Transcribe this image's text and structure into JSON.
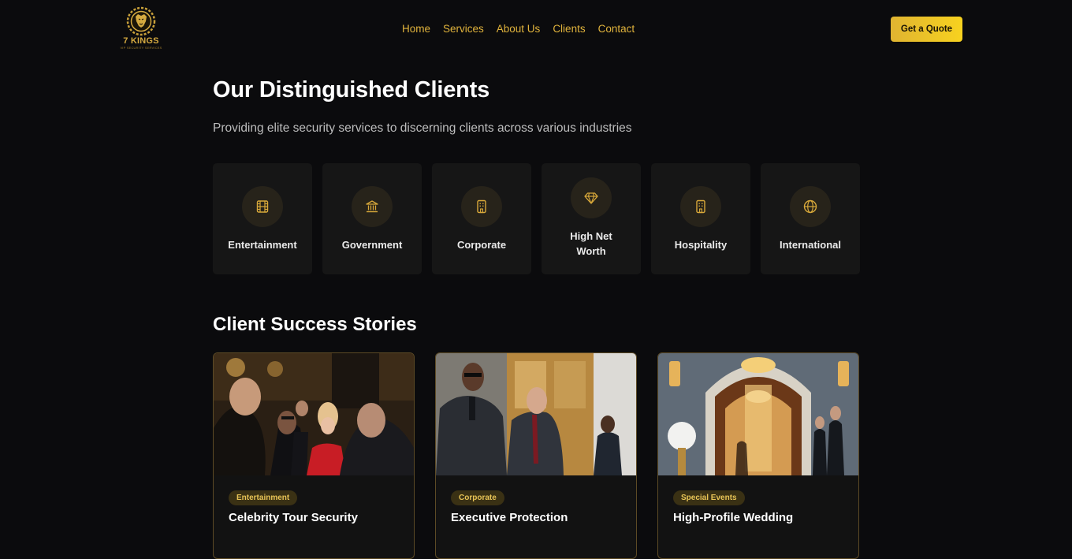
{
  "brand": {
    "name": "7 KINGS",
    "tagline": "VIP SECURITY SERVICES",
    "logo_icon": "lion-head-icon",
    "accent": "#e0b33c"
  },
  "nav": {
    "links": [
      "Home",
      "Services",
      "About Us",
      "Clients",
      "Contact"
    ],
    "cta": "Get a Quote"
  },
  "clients": {
    "title": "Our Distinguished Clients",
    "subtitle": "Providing elite security services to discerning clients across various industries",
    "categories": [
      {
        "label": "Entertainment",
        "icon": "film-icon"
      },
      {
        "label": "Government",
        "icon": "landmark-icon"
      },
      {
        "label": "Corporate",
        "icon": "building-icon"
      },
      {
        "label": "High Net Worth",
        "icon": "diamond-icon"
      },
      {
        "label": "Hospitality",
        "icon": "hotel-icon"
      },
      {
        "label": "International",
        "icon": "globe-icon"
      }
    ]
  },
  "stories": {
    "title": "Client Success Stories",
    "items": [
      {
        "category": "Entertainment",
        "title": "Celebrity Tour Security"
      },
      {
        "category": "Corporate",
        "title": "Executive Protection"
      },
      {
        "category": "Special Events",
        "title": "High-Profile Wedding"
      }
    ]
  }
}
